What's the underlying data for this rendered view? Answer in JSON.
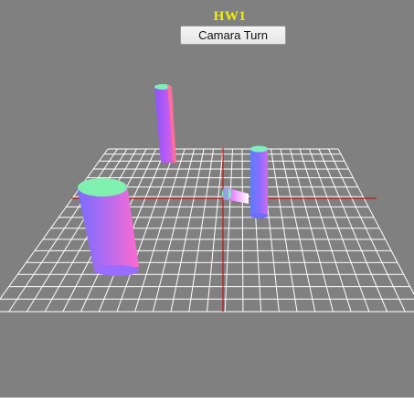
{
  "app": {
    "title": "HW1",
    "camera_button_label": "Camara Turn"
  },
  "colors": {
    "viewport_background": "#808080",
    "title_color": "#f2f200",
    "grid_line": "#ffffff",
    "axis_line": "#cc0000",
    "page_background": "#ffffff"
  },
  "scene": {
    "objects": [
      "cylinder-large-front-left",
      "cylinder-tall-back-left",
      "cylinder-tall-right",
      "cylinder-small-lying-center"
    ]
  }
}
